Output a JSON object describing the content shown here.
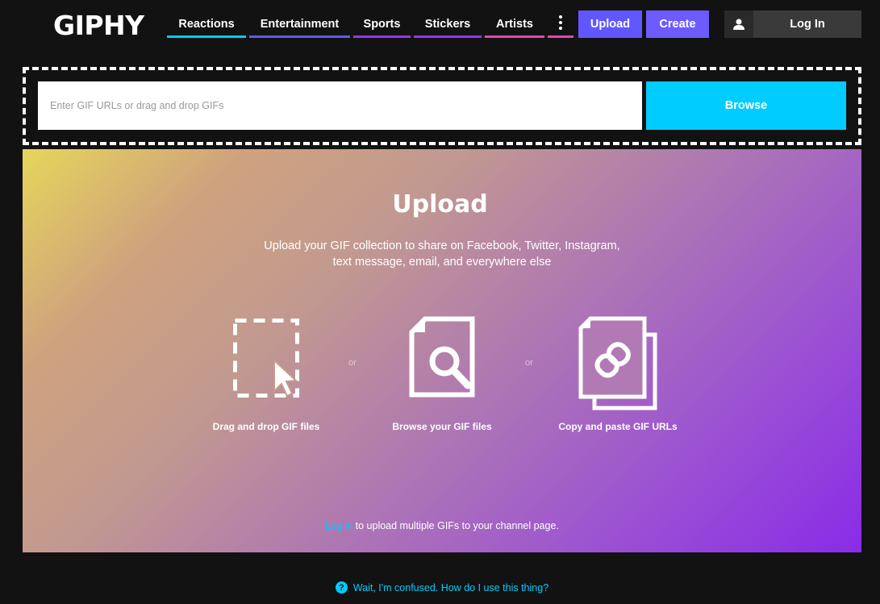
{
  "header": {
    "logo": "GIPHY",
    "nav": [
      {
        "label": "Reactions",
        "color": "#00ccff"
      },
      {
        "label": "Entertainment",
        "color": "#6157ff"
      },
      {
        "label": "Sports",
        "color": "#9933ff"
      },
      {
        "label": "Stickers",
        "color": "#9933ff"
      },
      {
        "label": "Artists",
        "color": "#e646b6"
      }
    ],
    "more_icon": "vertical-dots-icon",
    "upload_label": "Upload",
    "create_label": "Create",
    "login_label": "Log In",
    "user_icon": "user-icon"
  },
  "dropzone": {
    "placeholder": "Enter GIF URLs or drag and drop GIFs",
    "browse_label": "Browse"
  },
  "hero": {
    "title": "Upload",
    "subtitle_line1": "Upload your GIF collection to share on Facebook, Twitter, Instagram,",
    "subtitle_line2": "text message, email, and everywhere else",
    "options": [
      {
        "label": "Drag and drop GIF files",
        "icon": "drag-drop-icon"
      },
      {
        "label": "Browse your GIF files",
        "icon": "browse-file-icon"
      },
      {
        "label": "Copy and paste GIF URLs",
        "icon": "copy-link-icon"
      }
    ],
    "or_text": "or",
    "login_link": "Log in",
    "login_note": " to upload multiple GIFs to your channel page."
  },
  "help": {
    "text": "Wait, I'm confused. How do I use this thing?",
    "icon": "question-icon"
  },
  "colors": {
    "upload_button": "#6157ff",
    "create_button": "#6e5bff",
    "browse_button": "#00ccff",
    "background": "#121212"
  }
}
